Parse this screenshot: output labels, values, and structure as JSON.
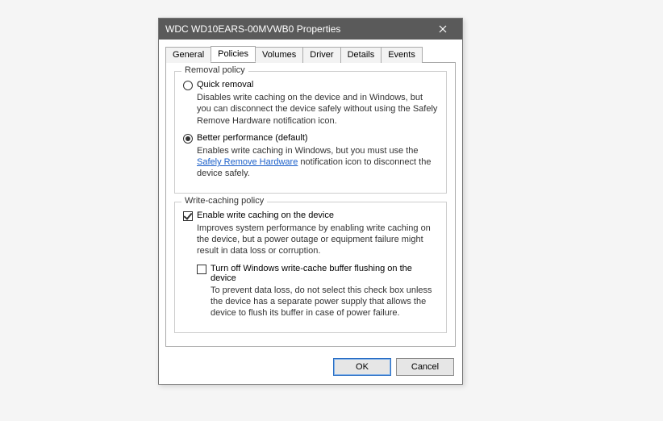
{
  "title": "WDC WD10EARS-00MVWB0 Properties",
  "tabs": {
    "general": "General",
    "policies": "Policies",
    "volumes": "Volumes",
    "driver": "Driver",
    "details": "Details",
    "events": "Events"
  },
  "group_removal": {
    "title": "Removal policy",
    "quick": {
      "label": "Quick removal",
      "desc": "Disables write caching on the device and in Windows, but you can disconnect the device safely without using the Safely Remove Hardware notification icon."
    },
    "better": {
      "label": "Better performance (default)",
      "desc_before": "Enables write caching in Windows, but you must use the ",
      "link": "Safely Remove Hardware",
      "desc_after": " notification icon to disconnect the device safely."
    }
  },
  "group_write": {
    "title": "Write-caching policy",
    "enable": {
      "label": "Enable write caching on the device",
      "desc": "Improves system performance by enabling write caching on the device, but a power outage or equipment failure might result in data loss or corruption."
    },
    "turnoff": {
      "label": "Turn off Windows write-cache buffer flushing on the device",
      "desc": "To prevent data loss, do not select this check box unless the device has a separate power supply that allows the device to flush its buffer in case of power failure."
    }
  },
  "buttons": {
    "ok": "OK",
    "cancel": "Cancel"
  }
}
